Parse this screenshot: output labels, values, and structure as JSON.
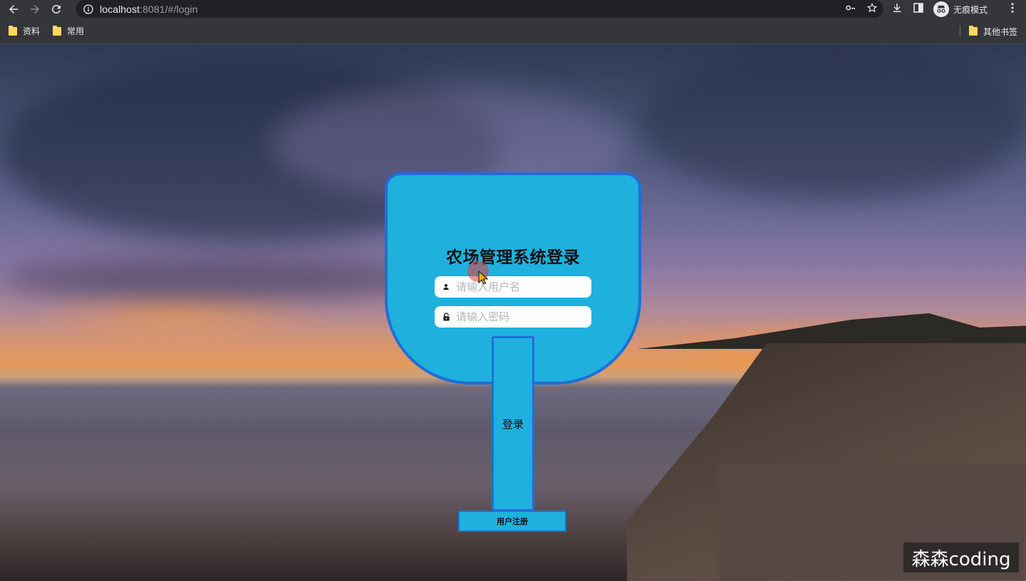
{
  "browser": {
    "url_host": "localhost",
    "url_rest": ":8081/#/login",
    "profile_label": "无痕模式",
    "bookmarks": [
      "资料",
      "常用"
    ],
    "other_bookmarks": "其他书签"
  },
  "login": {
    "title": "农场管理系统登录",
    "username_placeholder": "请输入用户名",
    "password_placeholder": "请输入密码",
    "login_label": "登录",
    "register_label": "用户注册"
  },
  "watermark": "森森coding",
  "colors": {
    "card_fill": "#1fb0de",
    "card_border": "#1f6fd6"
  }
}
